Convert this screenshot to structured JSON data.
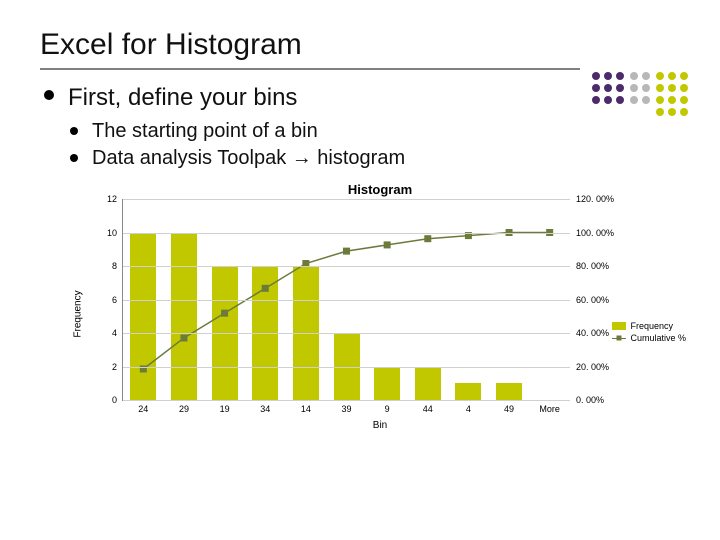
{
  "title": "Excel for Histogram",
  "bullets": {
    "l1": "First, define your bins",
    "sub": [
      "The starting point of a bin",
      "Data analysis Toolpak → histogram"
    ]
  },
  "chart_data": {
    "type": "bar",
    "title": "Histogram",
    "xlabel": "Bin",
    "ylabel": "Frequency",
    "ylim": [
      0,
      12
    ],
    "y_ticks": [
      0,
      2,
      4,
      6,
      8,
      10,
      12
    ],
    "y2_ticks": [
      "0. 00%",
      "20. 00%",
      "40. 00%",
      "60. 00%",
      "80. 00%",
      "100. 00%",
      "120. 00%"
    ],
    "categories": [
      "24",
      "29",
      "19",
      "34",
      "14",
      "39",
      "9",
      "44",
      "4",
      "49",
      "More"
    ],
    "series": [
      {
        "name": "Frequency",
        "values": [
          10,
          10,
          8,
          8,
          8,
          4,
          2,
          2,
          1,
          1,
          0
        ]
      },
      {
        "name": "Cumulative %",
        "values": [
          18.52,
          37.04,
          51.85,
          66.67,
          81.48,
          88.89,
          92.59,
          96.3,
          98.15,
          100.0,
          100.0
        ],
        "y2lim": [
          0,
          120
        ]
      }
    ],
    "legend": [
      "Frequency",
      "Cumulative %"
    ]
  },
  "deco_colors": {
    "purple": "#4b2b6b",
    "olive": "#a8ad00",
    "gray": "#b8b8b8"
  }
}
